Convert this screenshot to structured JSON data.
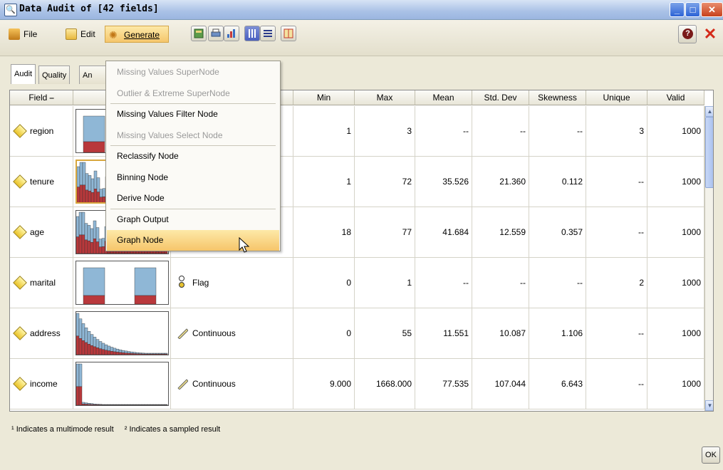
{
  "window": {
    "title": "Data Audit of [42 fields]"
  },
  "menu": {
    "file": "File",
    "edit": "Edit",
    "generate": "Generate"
  },
  "tabs": [
    "Audit",
    "Quality",
    "An"
  ],
  "columns": {
    "field": "Field",
    "min": "Min",
    "max": "Max",
    "mean": "Mean",
    "std": "Std. Dev",
    "skew": "Skewness",
    "unique": "Unique",
    "valid": "Valid"
  },
  "rows": [
    {
      "field": "region",
      "measurement": "",
      "min": "1",
      "max": "3",
      "mean": "--",
      "std": "--",
      "skew": "--",
      "unique": "3",
      "valid": "1000"
    },
    {
      "field": "tenure",
      "measurement": "",
      "min": "1",
      "max": "72",
      "mean": "35.526",
      "std": "21.360",
      "skew": "0.112",
      "unique": "--",
      "valid": "1000"
    },
    {
      "field": "age",
      "measurement": "",
      "min": "18",
      "max": "77",
      "mean": "41.684",
      "std": "12.559",
      "skew": "0.357",
      "unique": "--",
      "valid": "1000"
    },
    {
      "field": "marital",
      "measurement": "Flag",
      "min": "0",
      "max": "1",
      "mean": "--",
      "std": "--",
      "skew": "--",
      "unique": "2",
      "valid": "1000"
    },
    {
      "field": "address",
      "measurement": "Continuous",
      "min": "0",
      "max": "55",
      "mean": "11.551",
      "std": "10.087",
      "skew": "1.106",
      "unique": "--",
      "valid": "1000"
    },
    {
      "field": "income",
      "measurement": "Continuous",
      "min": "9.000",
      "max": "1668.000",
      "mean": "77.535",
      "std": "107.044",
      "skew": "6.643",
      "unique": "--",
      "valid": "1000"
    }
  ],
  "generate_menu": [
    {
      "label": "Missing Values SuperNode",
      "enabled": false
    },
    {
      "label": "Outlier & Extreme SuperNode",
      "enabled": false
    },
    {
      "label": "Missing Values Filter Node",
      "enabled": true
    },
    {
      "label": "Missing Values Select Node",
      "enabled": false
    },
    {
      "label": "Reclassify Node",
      "enabled": true
    },
    {
      "label": "Binning Node",
      "enabled": true
    },
    {
      "label": "Derive Node",
      "enabled": true
    },
    {
      "label": "Graph Output",
      "enabled": true
    },
    {
      "label": "Graph Node",
      "enabled": true,
      "highlighted": true
    }
  ],
  "footnotes": {
    "multimode": "¹ Indicates a multimode result",
    "sampled": "² Indicates a sampled result"
  },
  "ok_label": "OK",
  "colors": {
    "bar_blue": "#8fb7d6",
    "bar_red": "#b9383b",
    "highlight": "#f6c56a"
  },
  "icons": [
    "window-icon",
    "file-icon",
    "edit-icon",
    "generate-icon",
    "help-icon",
    "close-icon",
    "flag-icon",
    "continuous-icon"
  ]
}
